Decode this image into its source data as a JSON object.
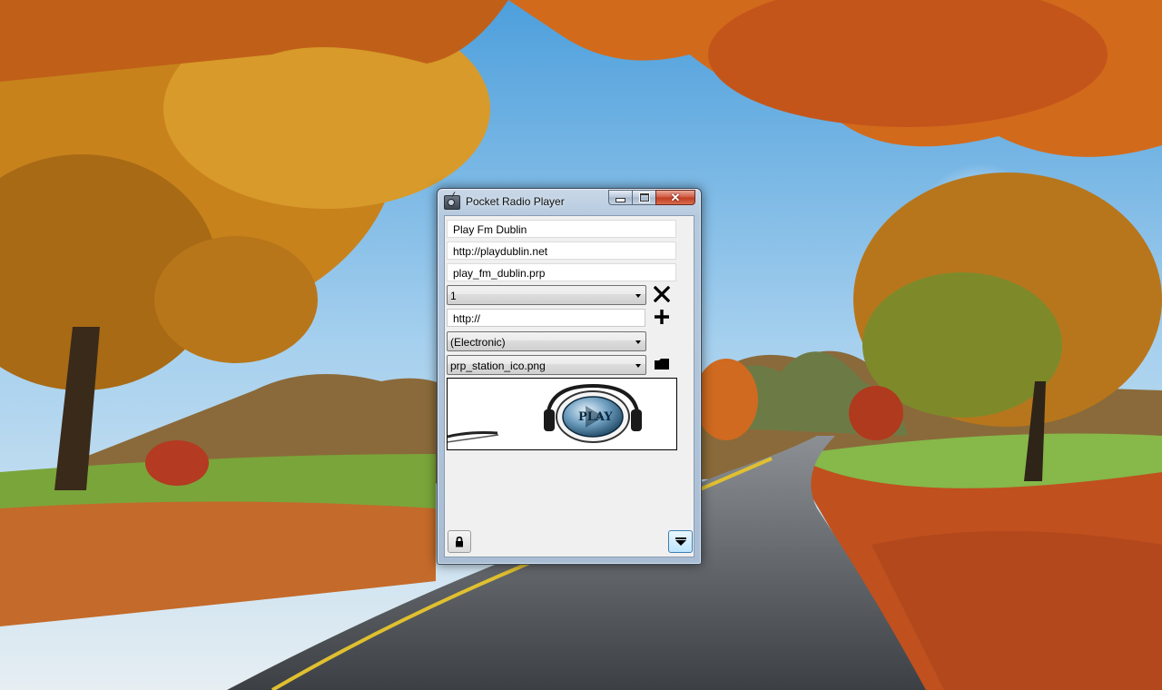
{
  "window": {
    "title": "Pocket Radio Player"
  },
  "station": {
    "name": "Play Fm Dublin",
    "website": "http://playdublin.net",
    "file": "play_fm_dublin.prp"
  },
  "stream_select": {
    "value": "1"
  },
  "stream_url": {
    "value": "http://"
  },
  "genre_select": {
    "value": "(Electronic)"
  },
  "icon_select": {
    "value": "prp_station_ico.png"
  },
  "preview_logo": {
    "text": "PLAY"
  },
  "icons": {
    "app": "radio-icon",
    "remove": "close-x-icon",
    "add": "plus-icon",
    "browse": "folder-icon",
    "lock": "lock-icon",
    "collapse": "collapse-arrow-icon"
  },
  "colors": {
    "close_button": "#c03c22",
    "collapse_button_border": "#3c7fb1",
    "client_background": "#f0f0f0"
  }
}
